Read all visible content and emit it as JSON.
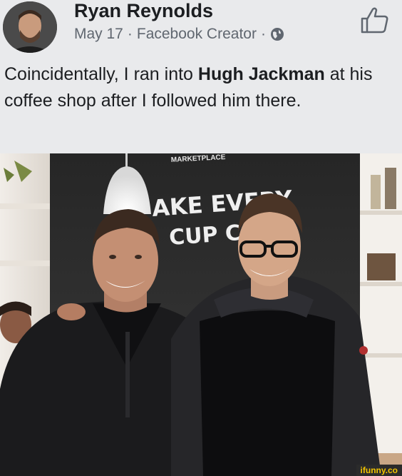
{
  "post": {
    "author": "Ryan Reynolds",
    "date": "May 17",
    "separator1": "·",
    "role": "Facebook Creator",
    "separator2": "·",
    "privacy_icon": "globe-icon",
    "like_icon": "thumbs-up-icon",
    "text_part1": "Coincidentally, I ran into ",
    "text_bold": "Hugh Jackman",
    "text_part2": " at his coffee shop after I followed him there."
  },
  "photo": {
    "sign_top": "MARKETPLACE",
    "sign_line1": "AKE EVERY",
    "sign_line2": "CUP C"
  },
  "watermark": "ifunny.co"
}
